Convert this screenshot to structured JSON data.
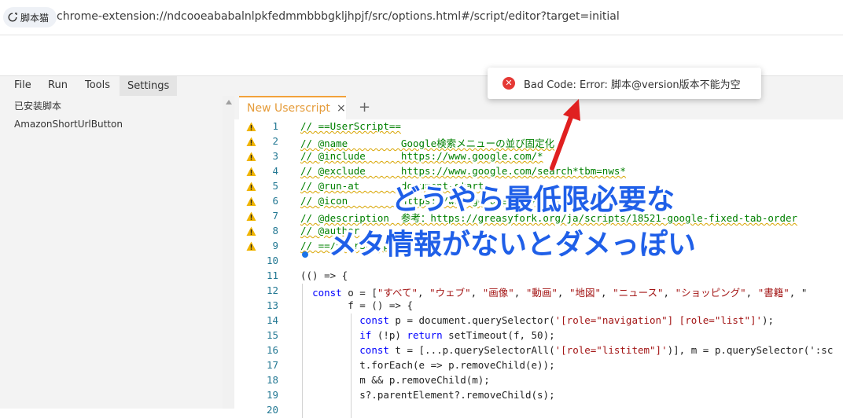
{
  "browser": {
    "chip_label": "脚本猫",
    "url": "chrome-extension://ndcooeababalnlpkfedmmbbbgkljhpjf/src/options.html#/script/editor?target=initial"
  },
  "menubar": {
    "items": [
      "File",
      "Run",
      "Tools",
      "Settings"
    ]
  },
  "sidebar": {
    "items": [
      "已安装脚本",
      "AmazonShortUrlButton"
    ]
  },
  "editor": {
    "tab_label": "New Userscript",
    "tab_close": "×",
    "tab_add": "+",
    "lines": [
      {
        "n": "1",
        "warn": true,
        "text": "// ==UserScript=="
      },
      {
        "n": "2",
        "warn": true,
        "text": "// @name         Google検索メニューの並び固定化"
      },
      {
        "n": "3",
        "warn": true,
        "text": "// @include      https://www.google.com/*"
      },
      {
        "n": "4",
        "warn": true,
        "text": "// @exclude      https://www.google.com/search*tbm=nws*"
      },
      {
        "n": "5",
        "warn": true,
        "text": "// @run-at       document-start"
      },
      {
        "n": "6",
        "warn": true,
        "text": "// @icon         https://www.google.com/favicon.ico"
      },
      {
        "n": "7",
        "warn": true,
        "text": "// @description  参考：https://greasyfork.org/ja/scripts/18521-google-fixed-tab-order"
      },
      {
        "n": "8",
        "warn": true,
        "text": "// @author"
      },
      {
        "n": "9",
        "warn": true,
        "text": "// ==/UserScript=="
      },
      {
        "n": "10",
        "warn": false,
        "text": ""
      },
      {
        "n": "11",
        "warn": false,
        "text": "(() => {"
      },
      {
        "n": "12",
        "warn": false,
        "text": "  const o = [\"すべて\", \"ウェブ\", \"画像\", \"動画\", \"地図\", \"ニュース\", \"ショッピング\", \"書籍\", \""
      },
      {
        "n": "13",
        "warn": false,
        "text": "        f = () => {"
      },
      {
        "n": "14",
        "warn": false,
        "text": "          const p = document.querySelector('[role=\"navigation\"] [role=\"list\"]');"
      },
      {
        "n": "15",
        "warn": false,
        "text": "          if (!p) return setTimeout(f, 50);"
      },
      {
        "n": "16",
        "warn": false,
        "text": "          const t = [...p.querySelectorAll('[role=\"listitem\"]')], m = p.querySelector(':sc"
      },
      {
        "n": "17",
        "warn": false,
        "text": "          t.forEach(e => p.removeChild(e));"
      },
      {
        "n": "18",
        "warn": false,
        "text": "          m && p.removeChild(m);"
      },
      {
        "n": "19",
        "warn": false,
        "text": "          s?.parentElement?.removeChild(s);"
      },
      {
        "n": "20",
        "warn": false,
        "text": ""
      }
    ]
  },
  "toast": {
    "message": "Bad Code: Error: 脚本@version版本不能为空",
    "icon": "error-icon"
  },
  "annotation": {
    "line1": "どうやら最低限必要な",
    "line2": "メタ情報がないとダメっぽい"
  },
  "colors": {
    "accent_tab": "#f2a13a",
    "comment": "#008000",
    "keyword": "#0000ff",
    "string": "#a31515",
    "annotation": "#1f5fe8",
    "arrow": "#e02020",
    "error": "#e53935"
  }
}
